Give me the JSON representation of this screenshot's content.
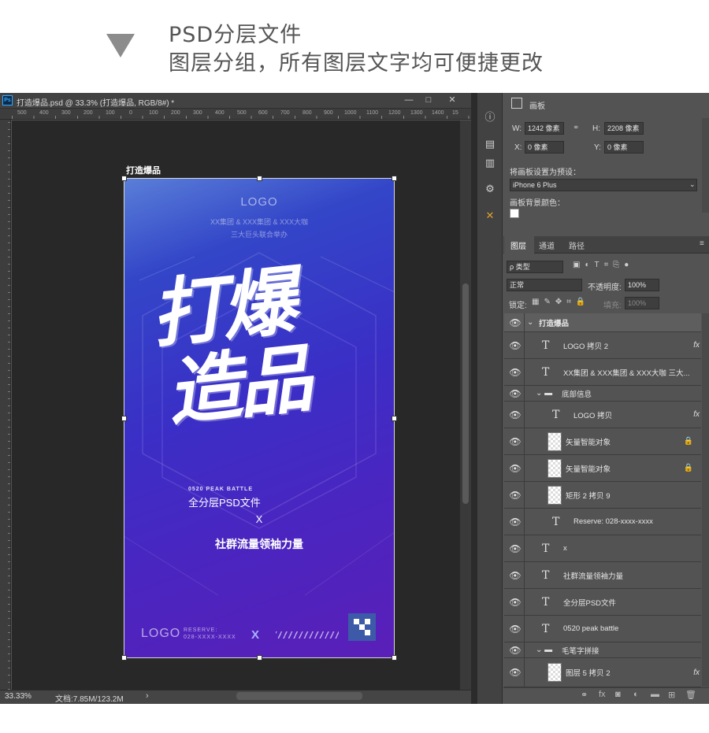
{
  "heading": {
    "line1": "PSD分层文件",
    "line2": "图层分组，所有图层文字均可便捷更改"
  },
  "document": {
    "tab_title": "打造爆品.psd @ 33.3% (打造爆品, RGB/8#) *",
    "ps_badge": "Ps",
    "minimize": "—",
    "restore": "□",
    "close": "✕",
    "ruler_labels": [
      "500",
      "400",
      "300",
      "200",
      "100",
      "0",
      "100",
      "200",
      "300",
      "400",
      "500",
      "600",
      "700",
      "800",
      "900",
      "1000",
      "1100",
      "1200",
      "1300",
      "1400",
      "15"
    ],
    "zoom": "33.33%",
    "doc_size": "文档:7.85M/123.2M",
    "nav_arrow": "›",
    "artboard_label": "打造爆品"
  },
  "poster": {
    "logo": "LOGO",
    "sub1": "XX集团 & XXX集团 & XXX大咖",
    "sub2": "三大巨头联合举办",
    "big_title_1": "打爆",
    "big_title_2": "造品",
    "peak": "0520 PEAK BATTLE",
    "all_psd": "全分层PSD文件",
    "x": "X",
    "slogan": "社群流量领袖力量",
    "bottom_logo": "LOGO",
    "reserve_1": "RESERVE:",
    "reserve_2": "028-XXXX-XXXX",
    "bottom_x": "X"
  },
  "properties": {
    "panel_title": "画板",
    "w_label": "W:",
    "w_value": "1242 像素",
    "h_label": "H:",
    "h_value": "2208 像素",
    "x_label": "X:",
    "x_value": "0 像素",
    "y_label": "Y:",
    "y_value": "0 像素",
    "preset_label": "将画板设置为预设：",
    "preset_value": "iPhone 6 Plus",
    "bg_label": "画板背景颜色："
  },
  "layers_panel": {
    "tabs": [
      "图层",
      "通道",
      "路径"
    ],
    "filter_label": "ρ 类型",
    "blend_mode": "正常",
    "opacity_label": "不透明度:",
    "opacity_value": "100%",
    "lock_label": "锁定:",
    "fill_label": "填充:",
    "fill_value": "100%",
    "rows": [
      {
        "name": "打造爆品",
        "kind": "artboard"
      },
      {
        "name": "LOGO 拷贝 2",
        "kind": "text",
        "fx": "fx"
      },
      {
        "name": "XX集团 & XXX集团 & XXX大咖 三大...",
        "kind": "text"
      },
      {
        "name": "底部信息",
        "kind": "group"
      },
      {
        "name": "LOGO 拷贝",
        "kind": "text",
        "fx": "fx"
      },
      {
        "name": "矢量智能对象",
        "kind": "smart"
      },
      {
        "name": "矢量智能对象",
        "kind": "smart"
      },
      {
        "name": "矩形 2 拷贝 9",
        "kind": "shape"
      },
      {
        "name": "Reserve: 028-xxxx-xxxx",
        "kind": "text"
      },
      {
        "name": "x",
        "kind": "text"
      },
      {
        "name": "社群流量领袖力量",
        "kind": "text"
      },
      {
        "name": "全分层PSD文件",
        "kind": "text"
      },
      {
        "name": "0520 peak battle",
        "kind": "text"
      },
      {
        "name": "毛笔字拼接",
        "kind": "group"
      },
      {
        "name": "图层 5 拷贝 2",
        "kind": "smart",
        "fx": "fx"
      }
    ]
  }
}
